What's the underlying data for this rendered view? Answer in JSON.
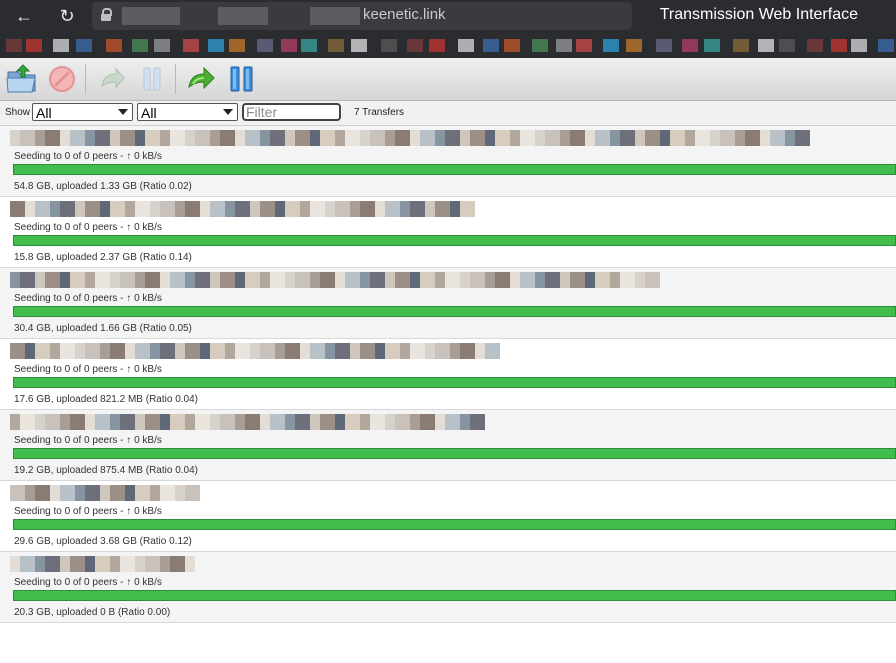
{
  "browser": {
    "domain": "keenetic.link",
    "page_title": "Transmission Web Interface"
  },
  "toolbar": {
    "buttons": [
      {
        "name": "open-torrent-button",
        "icon": "folder-open-icon"
      },
      {
        "name": "remove-torrent-button",
        "icon": "remove-icon"
      },
      {
        "name": "resume-selected-button",
        "icon": "resume-icon"
      },
      {
        "name": "pause-selected-button",
        "icon": "pause-icon"
      },
      {
        "name": "resume-all-button",
        "icon": "resume-all-icon"
      },
      {
        "name": "pause-all-button",
        "icon": "pause-all-icon"
      }
    ]
  },
  "filterbar": {
    "show_label": "Show",
    "state_filter": "All",
    "tracker_filter": "All",
    "filter_placeholder": "Filter",
    "transfer_count": "7 Transfers"
  },
  "colors": {
    "progress_green": "#3cb54a",
    "topbar": "#2b2c30"
  },
  "torrents": [
    {
      "peers": "Seeding to 0 of 0 peers - ↑ 0 kB/s",
      "stats": "54.8 GB, uploaded 1.33 GB (Ratio 0.02)",
      "progress": 1.0
    },
    {
      "peers": "Seeding to 0 of 0 peers - ↑ 0 kB/s",
      "stats": "15.8 GB, uploaded 2.37 GB (Ratio 0.14)",
      "progress": 1.0
    },
    {
      "peers": "Seeding to 0 of 0 peers - ↑ 0 kB/s",
      "stats": "30.4 GB, uploaded 1.66 GB (Ratio 0.05)",
      "progress": 1.0
    },
    {
      "peers": "Seeding to 0 of 0 peers - ↑ 0 kB/s",
      "stats": "17.6 GB, uploaded 821.2 MB (Ratio 0.04)",
      "progress": 1.0
    },
    {
      "peers": "Seeding to 0 of 0 peers - ↑ 0 kB/s",
      "stats": "19.2 GB, uploaded 875.4 MB (Ratio 0.04)",
      "progress": 1.0
    },
    {
      "peers": "Seeding to 0 of 0 peers - ↑ 0 kB/s",
      "stats": "29.6 GB, uploaded 3.68 GB (Ratio 0.12)",
      "progress": 1.0
    },
    {
      "peers": "Seeding to 0 of 0 peers - ↑ 0 kB/s",
      "stats": "20.3 GB, uploaded 0 B (Ratio 0.00)",
      "progress": 1.0
    }
  ]
}
